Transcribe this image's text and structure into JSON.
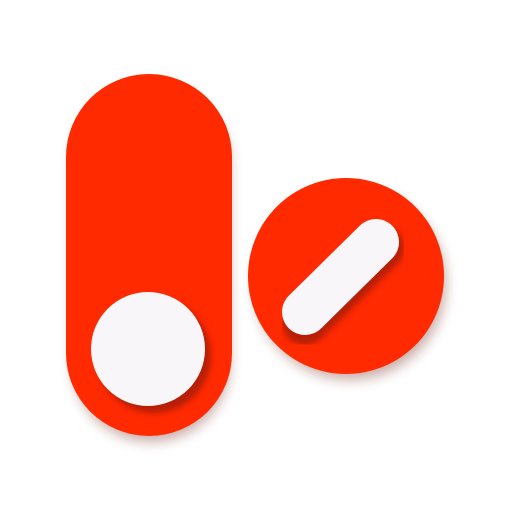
{
  "app_icon": {
    "name": "toggle-and-pill-icon",
    "colors": {
      "primary": "#ff2a00",
      "knob": "#f8f6f8",
      "shadow": "#8a1d10",
      "background": "#ffffff"
    },
    "toggle": {
      "state": "off",
      "knob_position": "bottom"
    },
    "pill": {
      "shape": "round",
      "bar_orientation": "diagonal"
    }
  }
}
